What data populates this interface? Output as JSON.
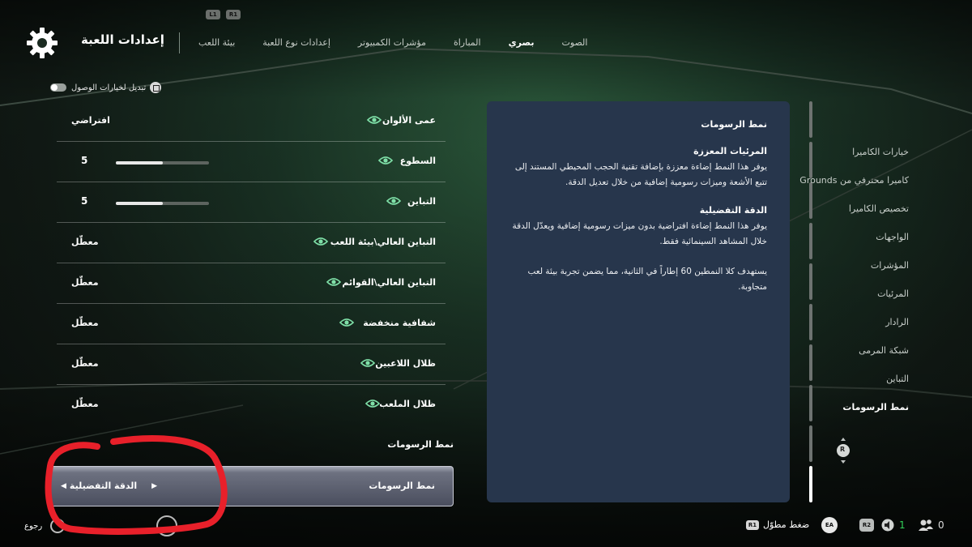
{
  "header": {
    "title": "إعدادات اللعبة",
    "bumper_left": "L1",
    "bumper_right": "R1",
    "tabs": [
      {
        "label": "بيئة اللعب",
        "active": false
      },
      {
        "label": "إعدادات نوع اللعبة",
        "active": false
      },
      {
        "label": "مؤشرات الكمبيوتر",
        "active": false
      },
      {
        "label": "المباراة",
        "active": false
      },
      {
        "label": "بصري",
        "active": true
      },
      {
        "label": "الصوت",
        "active": false
      }
    ]
  },
  "accessibility": {
    "label": "تبديل لخيارات الوصول",
    "on": false
  },
  "settings": {
    "rows": [
      {
        "label": "عمى الألوان",
        "value": "افتراضي",
        "eye": true
      },
      {
        "label": "السطوع",
        "value": "5",
        "slider": 0.5,
        "eye": true
      },
      {
        "label": "التباين",
        "value": "5",
        "slider": 0.5,
        "eye": true
      },
      {
        "label": "التباين العالي\\بيئة اللعب",
        "value": "معطّل",
        "eye": true
      },
      {
        "label": "التباين العالي\\القوائم",
        "value": "معطّل",
        "eye": true
      },
      {
        "label": "شفافية منخفضة",
        "value": "معطّل",
        "eye": true
      },
      {
        "label": "ظلال اللاعبين",
        "value": "معطّل",
        "eye": true
      },
      {
        "label": "ظلال الملعب",
        "value": "معطّل",
        "eye": true
      }
    ],
    "section_heading": "نمط الرسومات",
    "selected": {
      "label": "نمط الرسومات",
      "value": "الدقة التفضيلية"
    }
  },
  "panel": {
    "title": "نمط الرسومات",
    "sections": [
      {
        "subtitle": "المرئيات المعززة",
        "text": "يوفر هذا النمط إضاءة معززة بإضافة تقنية الحجب المحيطي المستند إلى تتبع الأشعة وميزات رسومية إضافية من خلال تعديل الدقة."
      },
      {
        "subtitle": "الدقة التفضيلية",
        "text": "يوفر هذا النمط إضاءة افتراضية بدون ميزات رسومية إضافية ويعدّل الدقة خلال المشاهد السينمائية فقط."
      },
      {
        "subtitle": "",
        "text": "يستهدف كلا النمطين 60 إطاراً في الثانية، مما يضمن تجربة بيئة لعب متجاوبة."
      }
    ]
  },
  "nav": {
    "items": [
      {
        "label": "خيارات الكاميرا",
        "active": false
      },
      {
        "label": "كاميرا محترفي من Grounds",
        "active": false
      },
      {
        "label": "تخصيص الكاميرا",
        "active": false
      },
      {
        "label": "الواجهات",
        "active": false
      },
      {
        "label": "المؤشرات",
        "active": false
      },
      {
        "label": "المرئيات",
        "active": false
      },
      {
        "label": "الرادار",
        "active": false
      },
      {
        "label": "شبكة المرمى",
        "active": false
      },
      {
        "label": "التباين",
        "active": false
      },
      {
        "label": "نمط الرسومات",
        "active": true
      }
    ],
    "rstick_label": "R"
  },
  "footer": {
    "back_label": "رجوع",
    "hold_label": "ضغط مطوّل",
    "r1_label": "R1",
    "ea_label": "EA",
    "r2_label": "R2",
    "speaker_count": "1",
    "people_count": "0"
  },
  "colors": {
    "accent_eye": "#7fe0a8",
    "panel_bg": "#27364c",
    "annotation": "#e8202a",
    "online_green": "#33d35a"
  }
}
